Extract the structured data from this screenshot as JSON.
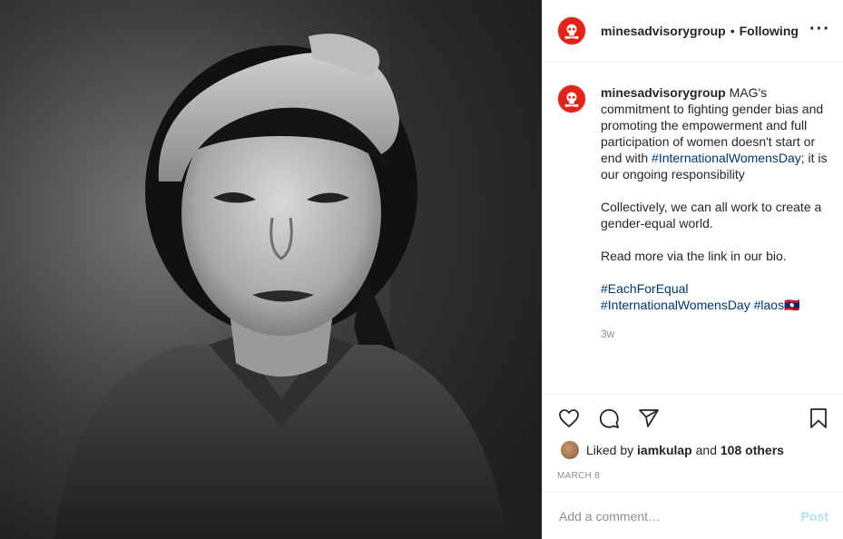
{
  "post": {
    "photo_alt": "photo",
    "account": "minesadvisorygroup",
    "dot": "•",
    "follow_status": "Following",
    "more_icon": "more-horizontal-icon",
    "caption": {
      "text_1": "MAG's commitment to fighting gender bias and promoting the empowerment and full participation of women doesn't start or end with",
      "hashtag_1": "#InternationalWomensDay",
      "text_2": "; it is our ongoing responsibility",
      "para_2": "Collectively, we can all work to create a gender-equal world.",
      "para_3": "Read more via the link in our bio.",
      "hashtag_2": "#EachForEqual",
      "hashtag_3": "#InternationalWomensDay",
      "hashtag_4": "#laos",
      "flag": "🇱🇦",
      "time": "3w"
    },
    "actions": {
      "like_icon": "heart-icon",
      "comment_icon": "comment-icon",
      "share_icon": "share-icon",
      "save_icon": "bookmark-icon"
    },
    "likes": {
      "prefix": "Liked by",
      "user": "iamkulap",
      "and": "and",
      "others": "108 others"
    },
    "date": "MARCH 8",
    "comment": {
      "placeholder": "Add a comment…",
      "post_label": "Post"
    },
    "colors": {
      "brand_red": "#e2231a",
      "hashtag": "#00376b",
      "post_disabled": "#b2dffc"
    }
  }
}
